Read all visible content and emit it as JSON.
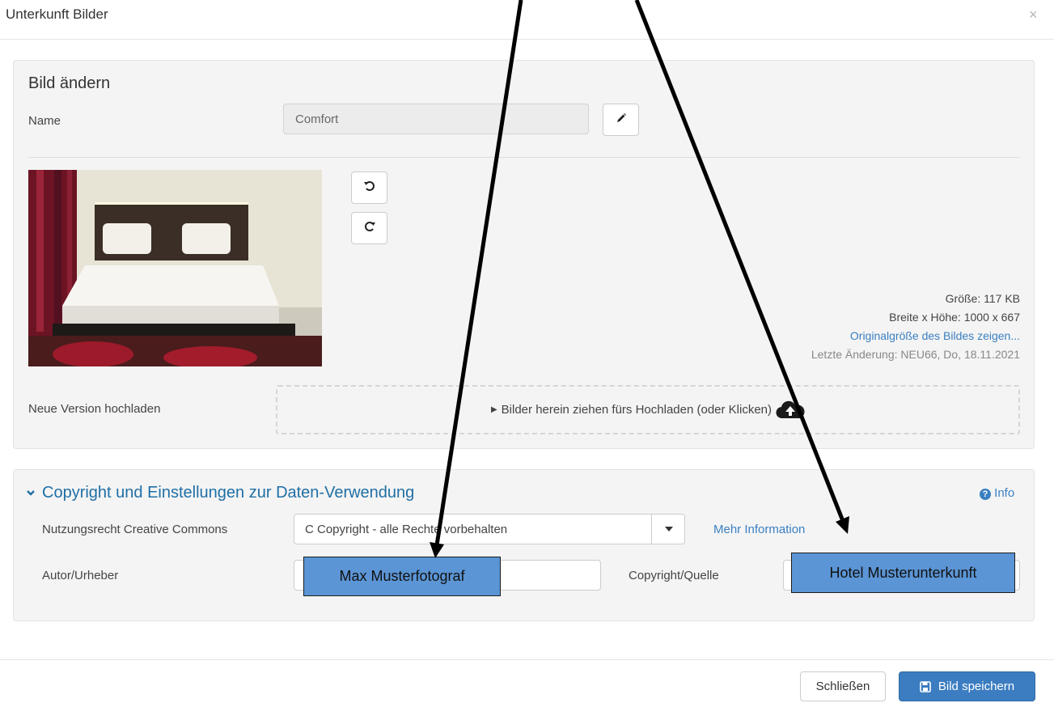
{
  "modal": {
    "title": "Unterkunft Bilder",
    "close": "×"
  },
  "edit": {
    "heading": "Bild ändern",
    "name_label": "Name",
    "name_value": "Comfort",
    "upload_label": "Neue Version hochladen",
    "dropzone_text": "Bilder herein ziehen fürs Hochladen (oder Klicken)"
  },
  "image_info": {
    "size": "Größe: 117 KB",
    "dimensions": "Breite x Höhe: 1000 x 667",
    "original_link": "Originalgröße des Bildes zeigen...",
    "last_change": "Letzte Änderung: NEU66, Do, 18.11.2021"
  },
  "copyright": {
    "title": "Copyright und Einstellungen zur Daten-Verwendung",
    "info": "Info",
    "license_label": "Nutzungsrecht Creative Commons",
    "license_value": "C Copyright - alle Rechte vorbehalten",
    "more_info": "Mehr Information",
    "author_label": "Autor/Urheber",
    "source_label": "Copyright/Quelle"
  },
  "callouts": {
    "author": "Max Musterfotograf",
    "source": "Hotel Musterunterkunft"
  },
  "footer": {
    "close": "Schließen",
    "save": "Bild speichern"
  },
  "colors": {
    "primary": "#3b7dc0",
    "link": "#3a7fc1",
    "callout": "#5b95d5"
  },
  "icons": [
    "pencil-icon",
    "rotate-left-icon",
    "rotate-right-icon",
    "cloud-upload-icon",
    "chevron-down-icon",
    "info-circle-icon",
    "floppy-disk-icon",
    "caret-right-icon"
  ]
}
